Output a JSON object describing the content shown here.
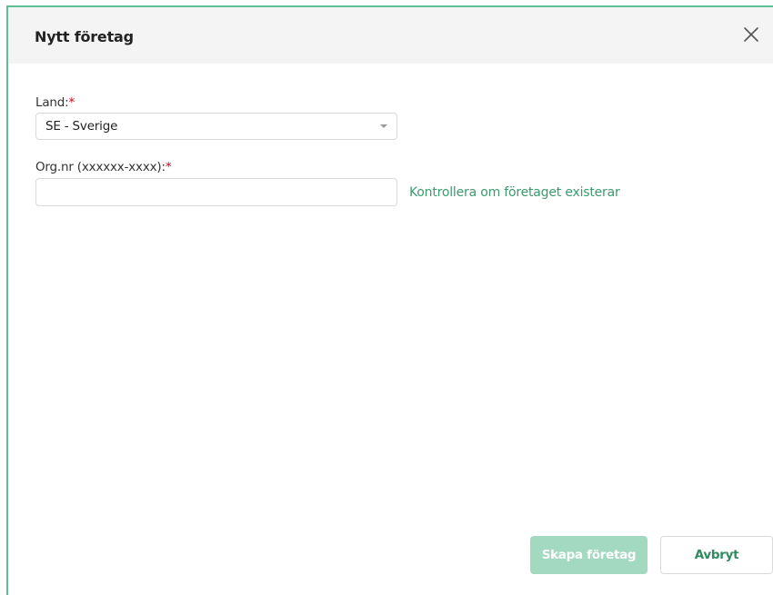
{
  "dialog": {
    "title": "Nytt företag",
    "close_icon": "close-icon"
  },
  "form": {
    "country": {
      "label": "Land:",
      "required_marker": "*",
      "value": "SE - Sverige"
    },
    "org_nr": {
      "label": "Org.nr (xxxxxx-xxxx):",
      "required_marker": "*",
      "value": "",
      "placeholder": ""
    },
    "check_link": "Kontrollera om företaget existerar"
  },
  "footer": {
    "create_label": "Skapa företag",
    "cancel_label": "Avbryt"
  },
  "colors": {
    "accent": "#5dbf95",
    "link": "#3d9a6d",
    "primary_disabled": "#a3d9c1",
    "required": "#d0021b"
  }
}
